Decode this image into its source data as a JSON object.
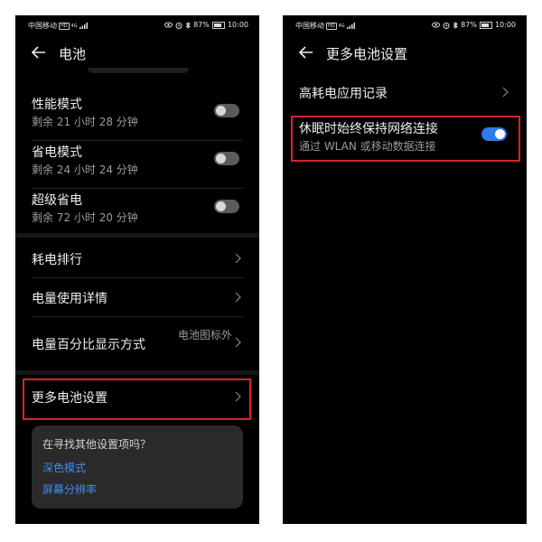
{
  "status_bar": {
    "carrier": "中国移动",
    "hd_badge": "HD",
    "network": "4G",
    "battery_percent": "87%",
    "time": "10:00"
  },
  "left_screen": {
    "title": "电池",
    "modes": [
      {
        "title": "性能模式",
        "subtitle": "剩余 21 小时 28 分钟",
        "enabled": false
      },
      {
        "title": "省电模式",
        "subtitle": "剩余 24 小时 24 分钟",
        "enabled": false
      },
      {
        "title": "超级省电",
        "subtitle": "剩余 72 小时 20 分钟",
        "enabled": false
      }
    ],
    "power_rank": "耗电排行",
    "usage_details": "电量使用详情",
    "percent_display": {
      "label": "电量百分比显示方式",
      "value": "电池图标外"
    },
    "more_settings": "更多电池设置",
    "suggestions": {
      "question": "在寻找其他设置项吗？",
      "links": [
        "深色模式",
        "屏幕分辨率"
      ]
    }
  },
  "right_screen": {
    "title": "更多电池设置",
    "high_usage_record": "高耗电应用记录",
    "keep_network": {
      "title": "休眠时始终保持网络连接",
      "subtitle": "通过 WLAN 或移动数据连接",
      "enabled": true
    }
  },
  "colors": {
    "background": "#000000",
    "accent": "#2f7bea",
    "link": "#3d8ef0",
    "highlight": "#d8232a"
  }
}
